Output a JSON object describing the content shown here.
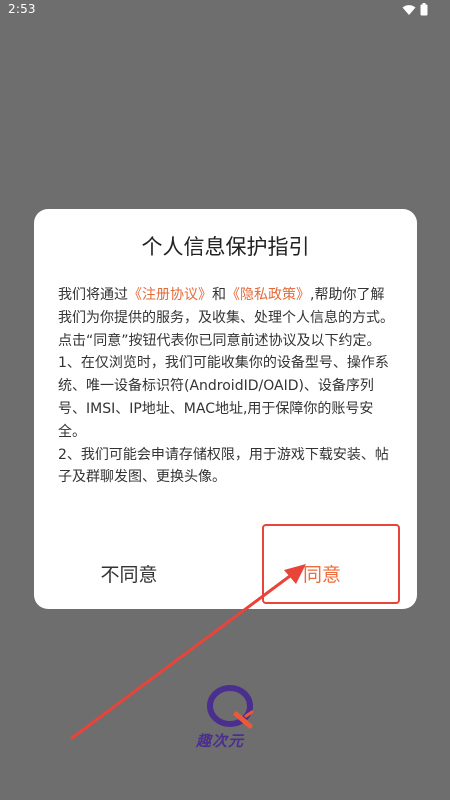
{
  "status_bar": {
    "time": "2:53",
    "icons": [
      "wifi-icon",
      "battery-icon"
    ]
  },
  "dialog": {
    "title": "个人信息保护指引",
    "body": {
      "p1_prefix": "我们将通过",
      "link_register": "《注册协议》",
      "p1_and": "和",
      "link_privacy": "《隐私政策》",
      "p1_suffix": ",帮助你了解我们为你提供的服务，及收集、处理个人信息的方式。",
      "p2": "点击“同意”按钮代表你已同意前述协议及以下约定。",
      "p3": "1、在仅浏览时，我们可能收集你的设备型号、操作系统、唯一设备标识符(AndroidID/OAID)、设备序列号、IMSI、IP地址、MAC地址,用于保障你的账号安全。",
      "p4": "2、我们可能会申请存储权限，用于游戏下载安装、帖子及群聊发图、更换头像。"
    },
    "buttons": {
      "disagree": "不同意",
      "agree": "同意"
    }
  },
  "brand": {
    "logo_text": "趣次元"
  },
  "colors": {
    "overlay": "#6e6e6e",
    "link": "#e36b3a",
    "agree": "#ef6b3c",
    "annotation": "#e8443a"
  }
}
